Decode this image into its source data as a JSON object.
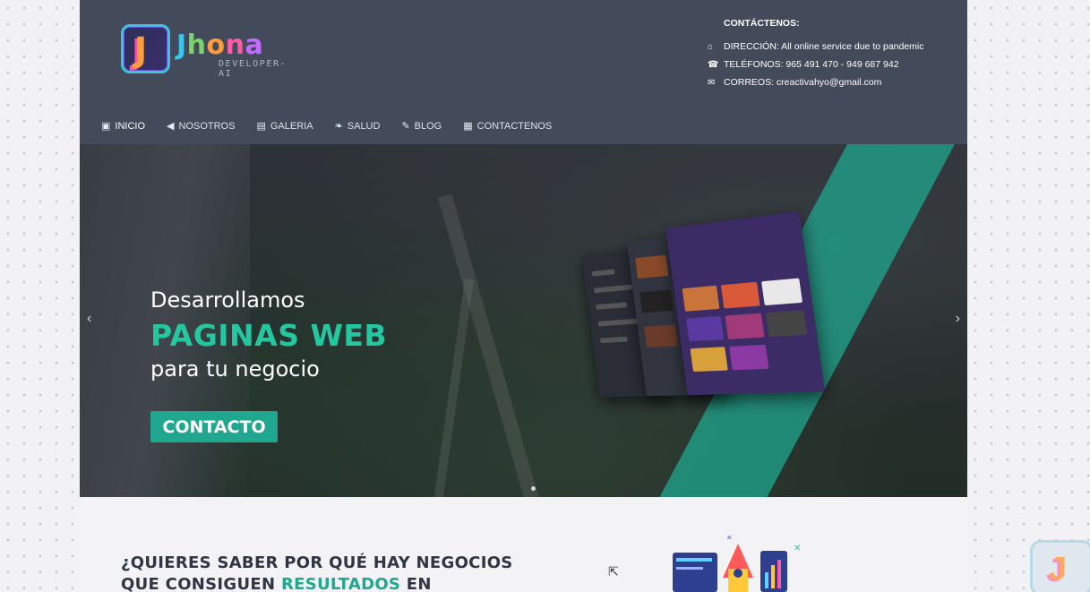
{
  "brand": {
    "badge": "J",
    "name": "Jhona",
    "subtitle": "DEVELOPER-AI"
  },
  "contact": {
    "title": "CONTÁCTENOS:",
    "address": "DIRECCIÓN: All online service due to pandemic",
    "phones": "TELÉFONOS: 965 491 470 - 949 687 942",
    "email": "CORREOS: creactivahyo@gmail.com"
  },
  "nav": [
    {
      "label": "INICIO",
      "icon": "home-icon"
    },
    {
      "label": "NOSOTROS",
      "icon": "megaphone-icon"
    },
    {
      "label": "GALERIA",
      "icon": "gallery-icon"
    },
    {
      "label": "SALUD",
      "icon": "leaf-icon"
    },
    {
      "label": "BLOG",
      "icon": "edit-icon"
    },
    {
      "label": "CONTACTENOS",
      "icon": "contact-card-icon"
    }
  ],
  "hero": {
    "line1": "Desarrollamos",
    "line2": "PAGINAS WEB",
    "line3": "para tu negocio",
    "button": "CONTACTO"
  },
  "section": {
    "line1": "¿QUIERES SABER POR QUÉ HAY NEGOCIOS",
    "line2_prefix": "QUE CONSIGUEN ",
    "line2_highlight": "RESULTADOS",
    "line2_suffix": " EN"
  },
  "colors": {
    "header": "#434a5a",
    "accent": "#1fa78f",
    "accent_text": "#23c7a0"
  }
}
